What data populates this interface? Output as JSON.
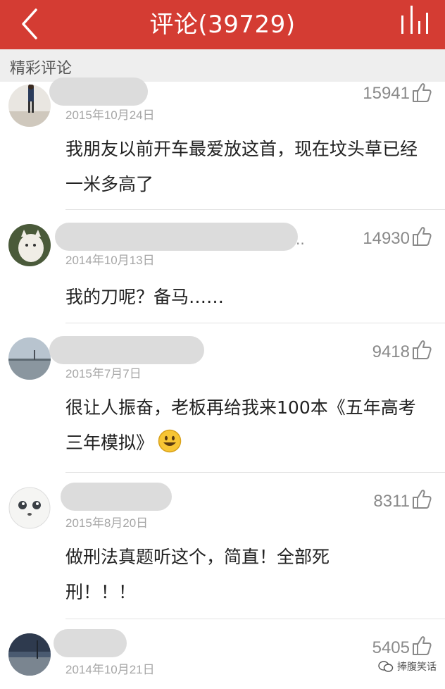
{
  "header": {
    "title": "评论(39729)",
    "back_icon": "chevron-left-icon",
    "chart_icon": "bar-chart-icon",
    "bg_color": "#d43c33"
  },
  "section": {
    "label": "精彩评论"
  },
  "comments": [
    {
      "date": "2015年10月24日",
      "likes": "15941",
      "text": "我朋友以前开车最爱放这首，现在坟头草已经一米多高了"
    },
    {
      "date": "2014年10月13日",
      "likes": "14930",
      "name_suffix": "..",
      "text": "我的刀呢？备马……"
    },
    {
      "date": "2015年7月7日",
      "likes": "9418",
      "text": "很让人振奋，老板再给我来100本《五年高考三年模拟》"
    },
    {
      "date": "2015年8月20日",
      "likes": "8311",
      "text": "做刑法真题听这个，简直！全部死刑！！！"
    },
    {
      "date": "2014年10月21日",
      "likes": "5405"
    }
  ],
  "watermark": {
    "text": "捧腹笑话"
  }
}
